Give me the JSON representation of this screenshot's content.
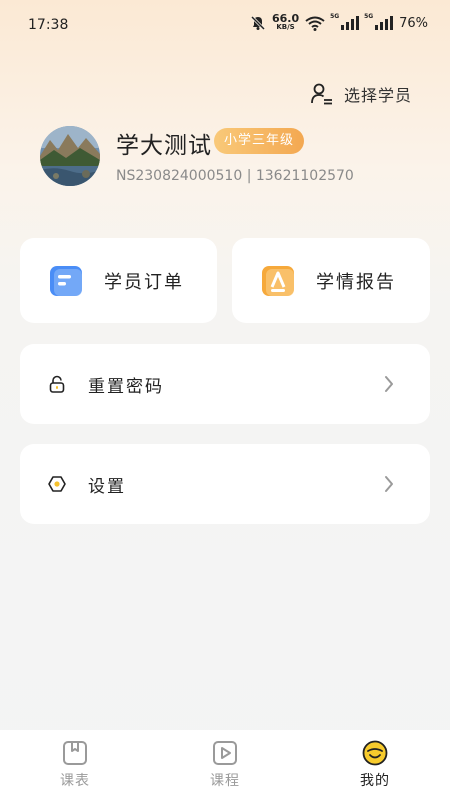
{
  "status_bar": {
    "time": "17:38",
    "net_speed_value": "66.0",
    "net_speed_unit": "KB/S",
    "signal1_tag": "5G",
    "signal2_tag": "5G",
    "battery": "76%"
  },
  "header": {
    "select_student_label": "选择学员"
  },
  "profile": {
    "name": "学大测试",
    "grade_badge": "小学三年级",
    "id_phone": "NS230824000510 | 13621102570"
  },
  "quick_actions": [
    {
      "label": "学员订单",
      "icon": "order-icon",
      "color": "#4a8df6"
    },
    {
      "label": "学情报告",
      "icon": "report-icon",
      "color": "#f6a93b"
    }
  ],
  "menu": [
    {
      "label": "重置密码",
      "icon": "lock-icon"
    },
    {
      "label": "设置",
      "icon": "settings-hexagon-icon"
    }
  ],
  "tabbar": {
    "items": [
      {
        "label": "课表",
        "icon": "timetable-icon",
        "active": false
      },
      {
        "label": "课程",
        "icon": "course-play-icon",
        "active": false
      },
      {
        "label": "我的",
        "icon": "smiley-me-icon",
        "active": true
      }
    ]
  },
  "colors": {
    "accent": "#f3a851",
    "active_yellow": "#f7cb2d"
  }
}
